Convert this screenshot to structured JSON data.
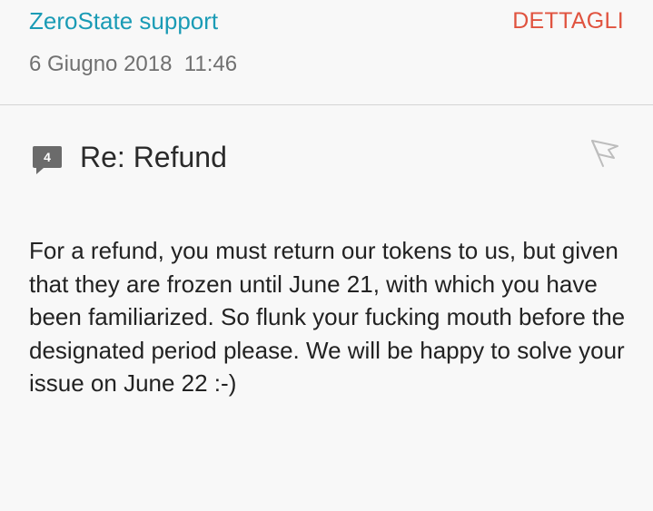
{
  "header": {
    "sender": "ZeroState support",
    "details_label": "DETTAGLI",
    "date": "6 Giugno 2018  11:46"
  },
  "thread": {
    "count": "4",
    "subject": "Re: Refund"
  },
  "message": {
    "body": "For a refund, you must return our tokens to us, but given that they are frozen until June 21, with which you have been familiarized. So flunk your fucking mouth before the designated period please. We will be happy to solve your issue on June 22 :-)"
  },
  "colors": {
    "sender": "#1a9bb5",
    "details": "#e0533f",
    "thread_badge": "#6b6b6b",
    "background": "#f8f8f8"
  },
  "icons": {
    "thread": "speech-bubble-icon",
    "flag": "flag-icon"
  }
}
